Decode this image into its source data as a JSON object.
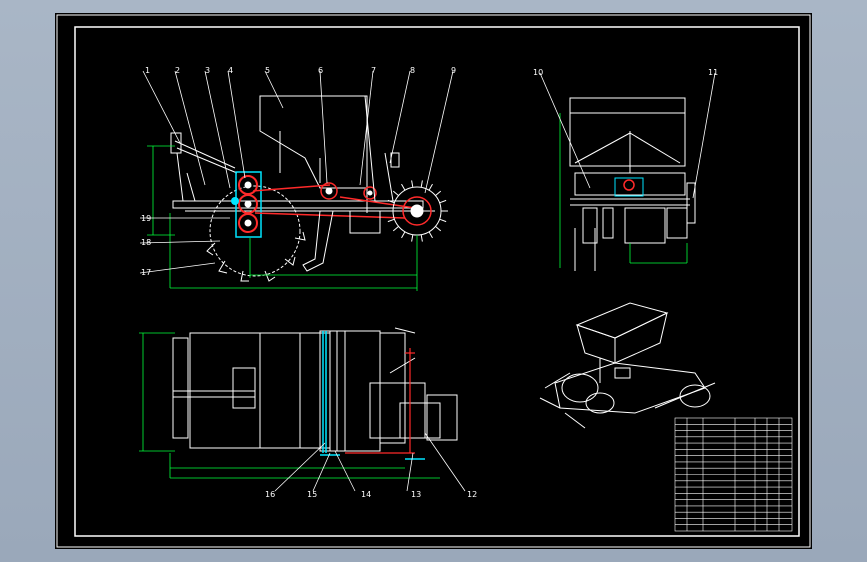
{
  "drawing": {
    "background": "#000000",
    "line_color": "#ffffff",
    "dimension_color": "#00ff3a",
    "highlight_color": "#ff2a2a",
    "accent_color": "#00e5ff",
    "callouts_front": [
      "1",
      "2",
      "3",
      "4",
      "5",
      "6",
      "7",
      "8",
      "9",
      "17",
      "18",
      "19"
    ],
    "callouts_side": [
      "10",
      "11"
    ],
    "callouts_top": [
      "12",
      "13",
      "14",
      "15",
      "16"
    ]
  }
}
